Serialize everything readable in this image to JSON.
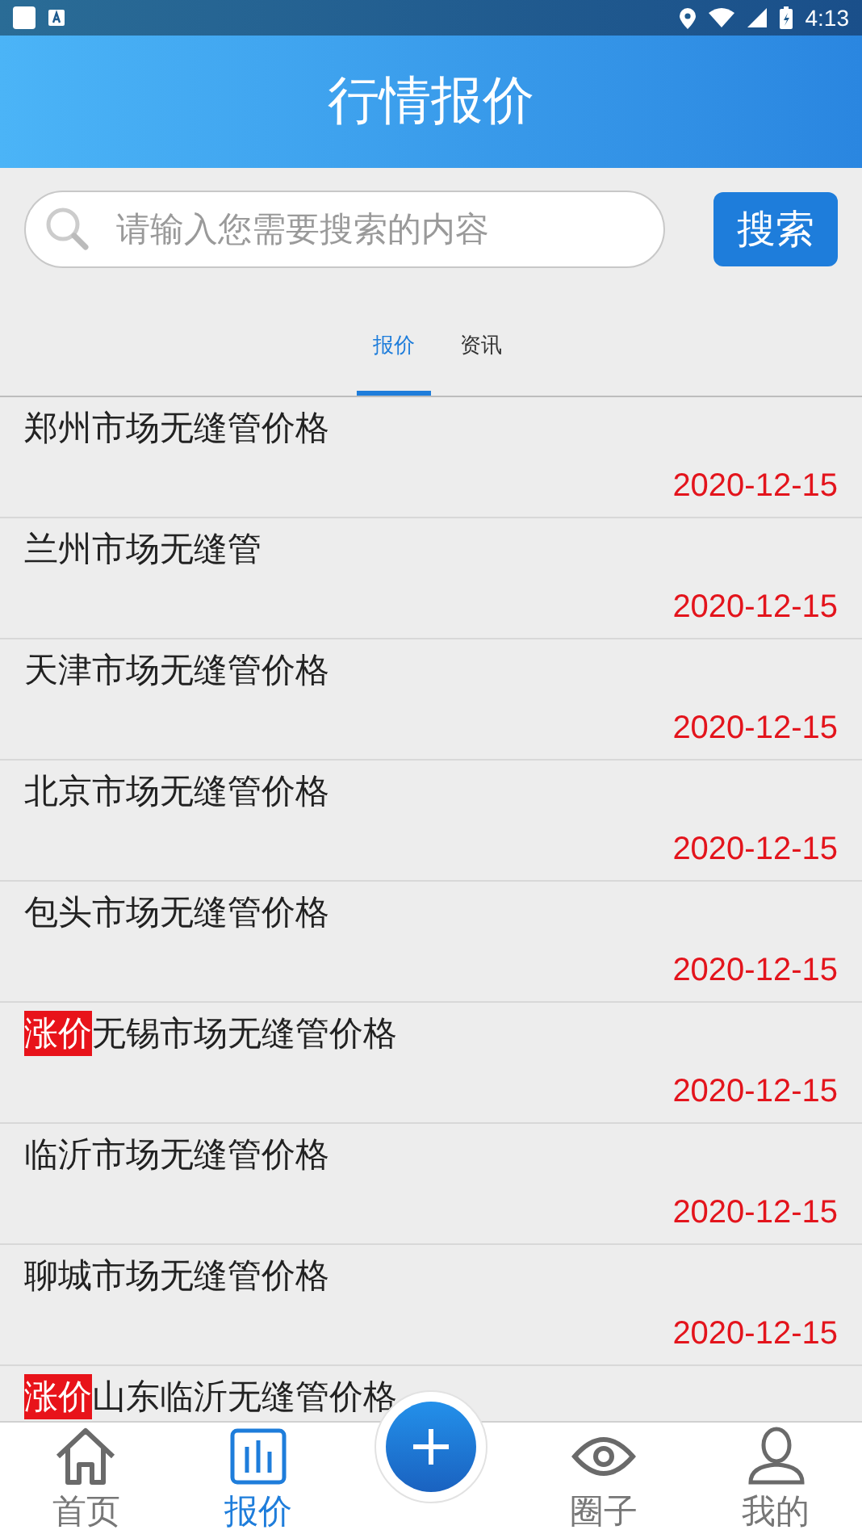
{
  "status_bar": {
    "time": "4:13"
  },
  "header": {
    "title": "行情报价"
  },
  "search": {
    "placeholder": "请输入您需要搜索的内容",
    "button": "搜索"
  },
  "tabs": [
    {
      "label": "报价",
      "selected": true
    },
    {
      "label": "资讯",
      "selected": false
    }
  ],
  "list": [
    {
      "title": "郑州市场无缝管价格",
      "date": "2020-12-15"
    },
    {
      "title": "兰州市场无缝管",
      "date": "2020-12-15"
    },
    {
      "title": "天津市场无缝管价格",
      "date": "2020-12-15"
    },
    {
      "title": "北京市场无缝管价格",
      "date": "2020-12-15"
    },
    {
      "title": "包头市场无缝管价格",
      "date": "2020-12-15"
    },
    {
      "tag": "涨价",
      "title": "无锡市场无缝管价格",
      "date": "2020-12-15"
    },
    {
      "title": "临沂市场无缝管价格",
      "date": "2020-12-15"
    },
    {
      "title": "聊城市场无缝管价格",
      "date": "2020-12-15"
    },
    {
      "tag": "涨价",
      "title": "山东临沂无缝管价格"
    }
  ],
  "nav": [
    {
      "kind": "home",
      "label": "首页",
      "selected": false
    },
    {
      "kind": "chart",
      "label": "报价",
      "selected": true
    },
    {
      "kind": "plus"
    },
    {
      "kind": "eye",
      "label": "圈子",
      "selected": false
    },
    {
      "kind": "person",
      "label": "我的",
      "selected": false
    }
  ]
}
